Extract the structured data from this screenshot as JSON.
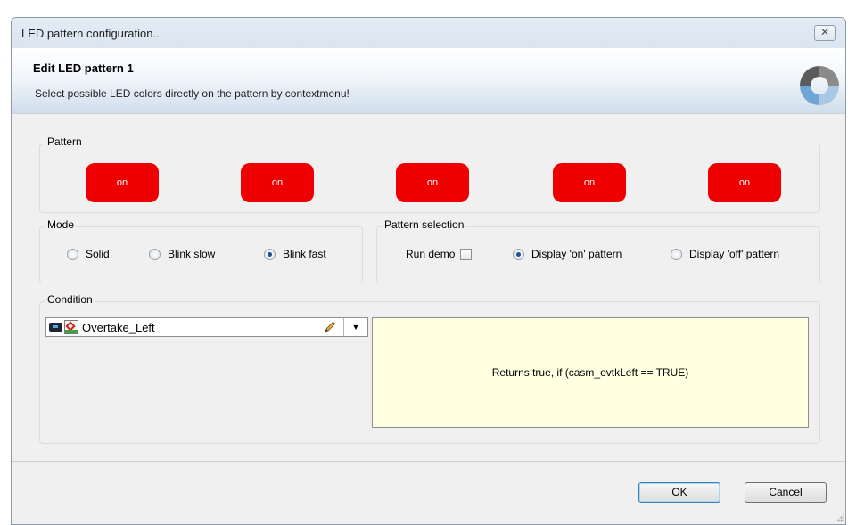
{
  "window": {
    "title": "LED pattern configuration...",
    "close_glyph": "✕"
  },
  "header": {
    "title": "Edit LED pattern 1",
    "subtitle": "Select possible LED colors directly on the pattern by contextmenu!"
  },
  "pattern": {
    "label": "Pattern",
    "leds": [
      "on",
      "on",
      "on",
      "on",
      "on"
    ],
    "led_color": "#ee0000"
  },
  "mode": {
    "label": "Mode",
    "options": [
      "Solid",
      "Blink slow",
      "Blink fast"
    ],
    "selected": "Blink fast"
  },
  "pattern_selection": {
    "label": "Pattern selection",
    "run_demo_label": "Run demo",
    "run_demo_checked": false,
    "options": [
      "Display 'on' pattern",
      "Display 'off' pattern"
    ],
    "selected": "Display 'on' pattern"
  },
  "condition": {
    "label": "Condition",
    "value": "Overtake_Left",
    "description": "Returns true, if (casm_ovtkLeft == TRUE)"
  },
  "buttons": {
    "ok": "OK",
    "cancel": "Cancel"
  },
  "icons": {
    "close": "close-icon",
    "logo": "app-logo-icon",
    "signal": "signal-icon",
    "condition": "condition-icon",
    "edit": "pencil-icon",
    "dropdown": "chevron-down-icon"
  }
}
